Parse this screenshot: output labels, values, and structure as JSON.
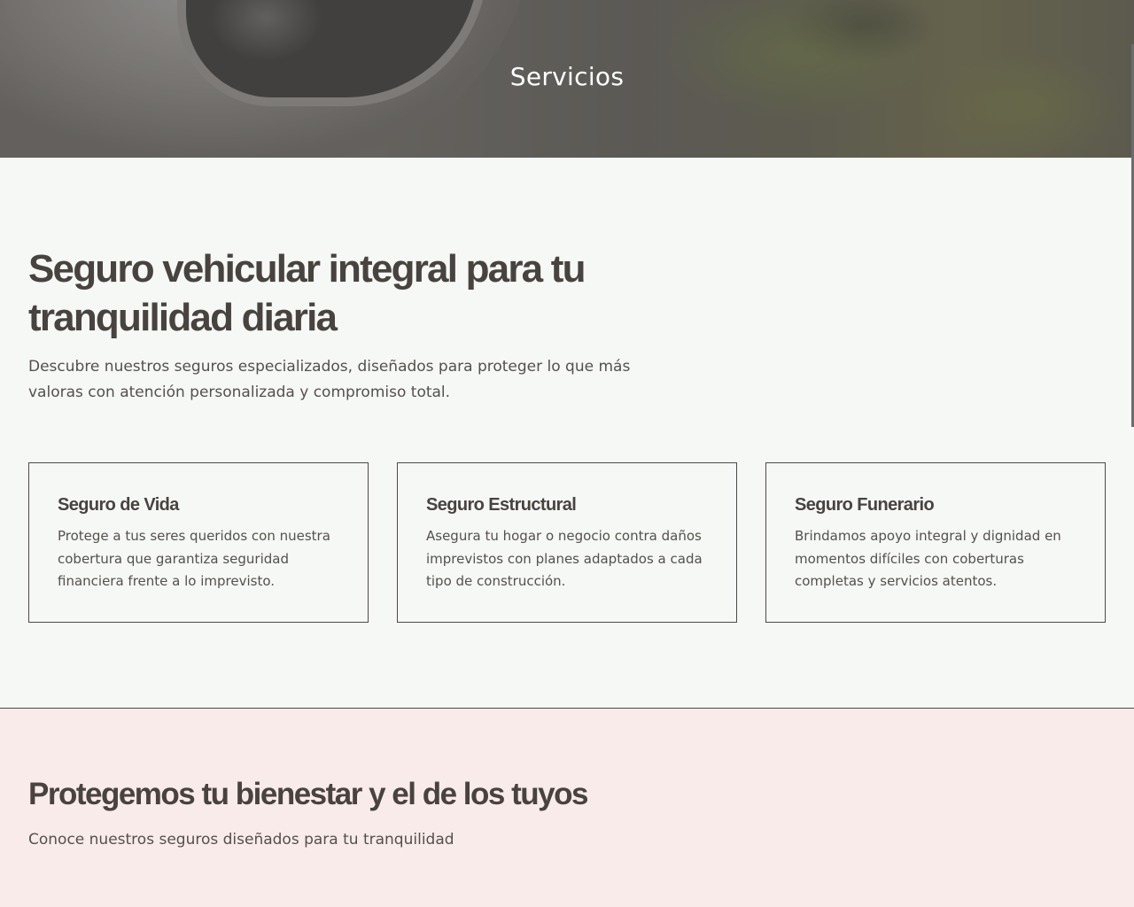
{
  "hero": {
    "title": "Servicios"
  },
  "intro": {
    "heading": "Seguro vehicular integral para tu tranquilidad diaria",
    "description": "Descubre nuestros seguros especializados, diseñados para proteger lo que más valoras con atención personalizada y compromiso total."
  },
  "cards": [
    {
      "title": "Seguro de Vida",
      "text": "Protege a tus seres queridos con nuestra cobertura que garantiza seguridad financiera frente a lo imprevisto."
    },
    {
      "title": "Seguro Estructural",
      "text": "Asegura tu hogar o negocio contra daños imprevistos con planes adaptados a cada tipo de construcción."
    },
    {
      "title": "Seguro Funerario",
      "text": "Brindamos apoyo integral y dignidad en momentos difíciles con coberturas completas y servicios atentos."
    }
  ],
  "wellbeing": {
    "heading": "Protegemos tu bienestar y el de los tuyos",
    "description": "Conoce nuestros seguros diseñados para tu tranquilidad"
  },
  "colors": {
    "section_bg": "#f6f8f6",
    "pink_section_bg": "#f9ebe9",
    "text_dark": "#48433f",
    "border": "#4e4a46"
  }
}
